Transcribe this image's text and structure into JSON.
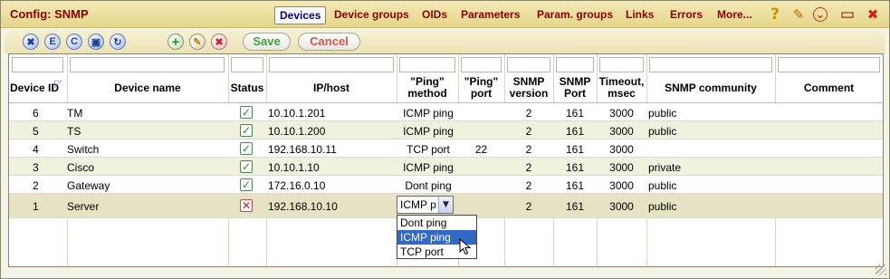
{
  "window": {
    "title": "Config: SNMP"
  },
  "tabs": [
    {
      "label": "Devices",
      "active": true
    },
    {
      "label": "Device groups",
      "active": false
    },
    {
      "label": "OIDs",
      "active": false
    },
    {
      "label": "Parameters",
      "active": false
    },
    {
      "label": "Param. groups",
      "active": false
    },
    {
      "label": "Links",
      "active": false
    },
    {
      "label": "Errors",
      "active": false
    },
    {
      "label": "More...",
      "active": false
    }
  ],
  "title_icons": [
    {
      "name": "help-icon",
      "glyph": "?"
    },
    {
      "name": "pencil-icon",
      "glyph": "✎"
    },
    {
      "name": "collapse-icon",
      "glyph": "⌄"
    },
    {
      "name": "maximize-icon",
      "glyph": "▭"
    },
    {
      "name": "close-icon",
      "glyph": "✖"
    }
  ],
  "toolbar": {
    "buttons": [
      {
        "name": "delete-all-button",
        "glyph": "✖"
      },
      {
        "name": "export-button",
        "glyph": "E"
      },
      {
        "name": "copy-button",
        "glyph": "C"
      },
      {
        "name": "save-icon-button",
        "glyph": "▣"
      },
      {
        "name": "refresh-button",
        "glyph": "↻"
      },
      {
        "name": "add-row-button",
        "glyph": "+"
      },
      {
        "name": "edit-row-button",
        "glyph": "✎"
      },
      {
        "name": "delete-row-button",
        "glyph": "✖"
      }
    ],
    "save_label": "Save",
    "cancel_label": "Cancel"
  },
  "colors": {
    "accent": "#8b0000",
    "save_text": "#3aa63a",
    "cancel_text": "#d9534f",
    "selected_option": "#316ac5"
  },
  "columns": [
    "Device ID",
    "Device name",
    "Status",
    "IP/host",
    "\"Ping\" method",
    "\"Ping\" port",
    "SNMP version",
    "SNMP Port",
    "Timeout, msec",
    "SNMP community",
    "Comment"
  ],
  "rows": [
    {
      "id": "6",
      "name": "TM",
      "status": "ok",
      "ip": "10.10.1.201",
      "ping_method": "ICMP ping",
      "ping_port": "",
      "snmp_version": "2",
      "snmp_port": "161",
      "timeout": "3000",
      "community": "public",
      "comment": ""
    },
    {
      "id": "5",
      "name": "TS",
      "status": "ok",
      "ip": "10.10.1.200",
      "ping_method": "ICMP ping",
      "ping_port": "",
      "snmp_version": "2",
      "snmp_port": "161",
      "timeout": "3000",
      "community": "public",
      "comment": ""
    },
    {
      "id": "4",
      "name": "Switch",
      "status": "ok",
      "ip": "192.168.10.11",
      "ping_method": "TCP port",
      "ping_port": "22",
      "snmp_version": "2",
      "snmp_port": "161",
      "timeout": "3000",
      "community": "",
      "comment": ""
    },
    {
      "id": "3",
      "name": "Cisco",
      "status": "ok",
      "ip": "10.10.1.10",
      "ping_method": "ICMP ping",
      "ping_port": "",
      "snmp_version": "2",
      "snmp_port": "161",
      "timeout": "3000",
      "community": "private",
      "comment": ""
    },
    {
      "id": "2",
      "name": "Gateway",
      "status": "ok",
      "ip": "172.16.0.10",
      "ping_method": "Dont ping",
      "ping_port": "",
      "snmp_version": "2",
      "snmp_port": "161",
      "timeout": "3000",
      "community": "public",
      "comment": ""
    },
    {
      "id": "1",
      "name": "Server",
      "status": "error",
      "ip": "192.168.10.10",
      "ping_method": "ICMP ping",
      "ping_port": "",
      "snmp_version": "2",
      "snmp_port": "161",
      "timeout": "3000",
      "community": "public",
      "comment": "",
      "editing": true
    }
  ],
  "editor": {
    "select_value": "ICMP p",
    "options": [
      "Dont ping",
      "ICMP ping",
      "TCP port"
    ],
    "highlighted_option": "ICMP ping"
  }
}
